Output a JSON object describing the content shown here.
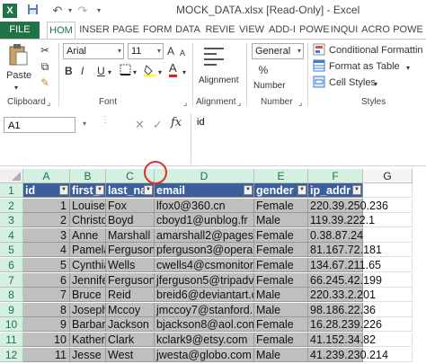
{
  "title_bar": {
    "title": "MOCK_DATA.xlsx  [Read-Only] - Excel",
    "icons": [
      "excel-logo-icon",
      "save-icon",
      "undo-icon",
      "redo-icon"
    ]
  },
  "ribbon_tabs": [
    "FILE",
    "HOM",
    "INSER",
    "PAGE",
    "FORM",
    "DATA",
    "REVIE",
    "VIEW",
    "ADD-I",
    "POWE",
    "INQUI",
    "ACRO",
    "POWE"
  ],
  "active_tab": "HOM",
  "ribbon": {
    "clipboard": {
      "paste_label": "Paste",
      "group_label": "Clipboard"
    },
    "font": {
      "font_name": "Arial",
      "font_size": "11",
      "group_label": "Font",
      "bold": "B",
      "italic": "I",
      "underline": "U",
      "grow": "A",
      "shrink": "A"
    },
    "alignment": {
      "group_label": "Alignment",
      "button_label": "Alignment"
    },
    "number": {
      "format": "General",
      "percent": "%",
      "group_label": "Number",
      "button_label": "Number"
    },
    "styles": {
      "conditional": "Conditional Formattin",
      "format_table": "Format as Table",
      "cell_styles": "Cell Styles",
      "group_label": "Styles"
    }
  },
  "formula_bar": {
    "name_box": "A1",
    "fx": "fx",
    "content": "id"
  },
  "grid": {
    "columns": [
      "A",
      "B",
      "C",
      "D",
      "E",
      "F",
      "G"
    ],
    "rows": [
      "1",
      "2",
      "3",
      "4",
      "5",
      "6",
      "7",
      "8",
      "9",
      "10",
      "11",
      "12"
    ],
    "headers": [
      "id",
      "first_",
      "last_na",
      "email",
      "gender",
      "ip_addr"
    ],
    "data": [
      [
        "1",
        "Louise",
        "Fox",
        "lfox0@360.cn",
        "Female",
        "220.39.250.236"
      ],
      [
        "2",
        "Christo",
        "Boyd",
        "cboyd1@unblog.fr",
        "Male",
        "119.39.222.1"
      ],
      [
        "3",
        "Anne",
        "Marshall",
        "amarshall2@pages.",
        "Female",
        "0.38.87.24"
      ],
      [
        "4",
        "Pamela",
        "Ferguson",
        "pferguson3@opera",
        "Female",
        "81.167.72.181"
      ],
      [
        "5",
        "Cynthia",
        "Wells",
        "cwells4@csmonitor",
        "Female",
        "134.67.211.65"
      ],
      [
        "6",
        "Jennife",
        "Ferguson",
        "jferguson5@tripadv",
        "Female",
        "66.245.42.199"
      ],
      [
        "7",
        "Bruce",
        "Reid",
        "breid6@deviantart.c",
        "Male",
        "220.33.2.201"
      ],
      [
        "8",
        "Joseph",
        "Mccoy",
        "jmccoy7@stanford.",
        "Male",
        "98.186.22.36"
      ],
      [
        "9",
        "Barbar",
        "Jackson",
        "bjackson8@aol.com",
        "Female",
        "16.28.239.226"
      ],
      [
        "10",
        "Katherin",
        "Clark",
        "kclark9@etsy.com",
        "Female",
        "41.152.34.82"
      ],
      [
        "11",
        "Jesse",
        "West",
        "jwesta@globo.com",
        "Male",
        "41.239.230.214"
      ]
    ]
  }
}
